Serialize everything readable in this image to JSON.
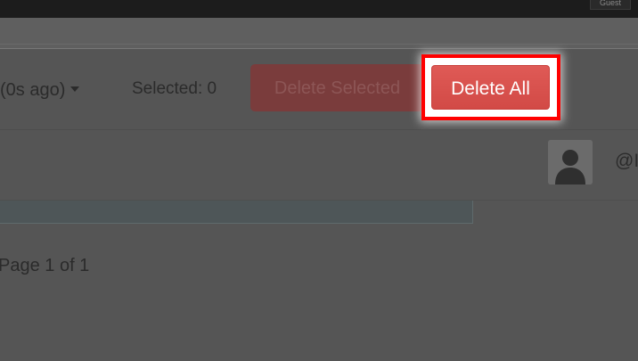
{
  "topbar": {
    "guest_label": "Guest"
  },
  "toolbar": {
    "refresh_label": "(0s ago)",
    "selected_text": "Selected: 0",
    "delete_selected_label": "Delete Selected",
    "delete_all_label": "Delete All"
  },
  "user_row": {
    "handle": "@I"
  },
  "pagination": {
    "text": "Page 1 of 1"
  },
  "colors": {
    "danger": "#d9534f",
    "highlight": "#ff0000",
    "overlay": "#555555"
  },
  "icons": {
    "avatar": "default-user-icon",
    "dropdown": "caret-down-icon"
  }
}
